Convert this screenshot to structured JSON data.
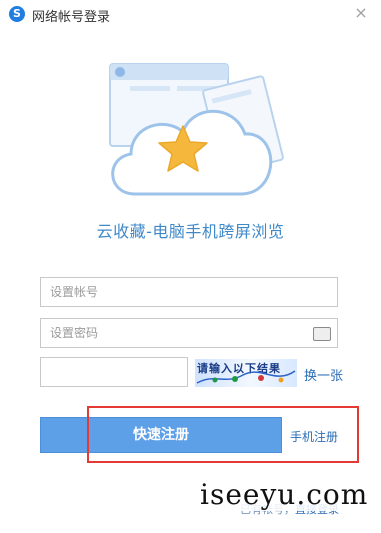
{
  "window": {
    "title": "网络帐号登录",
    "logo_glyph": "S",
    "close_glyph": "×"
  },
  "hero": {
    "icon": "cloud-star-icon",
    "slogan": "云收藏-电脑手机跨屏浏览"
  },
  "form": {
    "account_placeholder": "设置帐号",
    "password_placeholder": "设置密码",
    "captcha_value": "",
    "captcha_text": "请输入以下结果",
    "refresh_label": "换一张",
    "register_label": "快速注册",
    "phone_register_label": "手机注册"
  },
  "footer": {
    "hint_prefix": "已有帐号，",
    "hint_link": "直接登录"
  },
  "watermark": "iseeyu.com",
  "colors": {
    "accent": "#5ea0e8",
    "link": "#2a6db5",
    "highlight": "#e53935"
  }
}
